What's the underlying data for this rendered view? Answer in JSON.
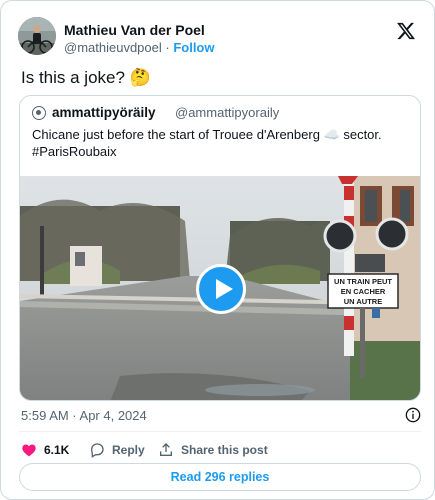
{
  "author": {
    "name": "Mathieu Van der Poel",
    "handle": "@mathieuvdpoel",
    "separator": " · ",
    "follow_label": "Follow"
  },
  "tweet": {
    "text": "Is this a joke? 🤔"
  },
  "quote": {
    "name": "ammattipyöräily",
    "handle": "@ammattipyoraily",
    "text_line1": "Chicane just before the start of Trouee d'Arenberg ☁️ sector.",
    "text_line2": "#ParisRoubaix",
    "sign": {
      "line1": "UN TRAIN PEUT",
      "line2": "EN CACHER",
      "line3": "UN AUTRE"
    }
  },
  "meta": {
    "timestamp": "5:59 AM · Apr 4, 2024"
  },
  "actions": {
    "like_count": "6.1K",
    "reply_label": "Reply",
    "share_label": "Share this post"
  },
  "read_replies_label": "Read 296 replies",
  "icons": {
    "like": "heart-icon",
    "reply": "reply-icon",
    "share": "share-icon",
    "info": "info-icon",
    "brand": "x-logo-icon"
  },
  "colors": {
    "accent": "#1d9bf0",
    "like": "#f91880",
    "text": "#0f1419",
    "muted": "#536471",
    "border": "#cfd9de"
  }
}
